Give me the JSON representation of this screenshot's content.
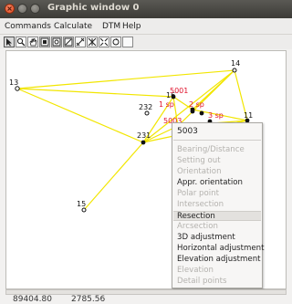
{
  "window": {
    "title": "Graphic window 0"
  },
  "menubar": {
    "items": [
      "Commands",
      "Calculate",
      "DTM",
      "Help"
    ]
  },
  "toolbar": {
    "tools": [
      "select-arrow-icon",
      "zoom-in-icon",
      "pan-hand-icon",
      "zoom-window-icon",
      "zoom-previous-icon",
      "zoom-all-icon",
      "measure-distance-icon",
      "intersection-icon",
      "fit-icon",
      "redraw-icon",
      "blank-icon"
    ]
  },
  "points": [
    {
      "label": "14"
    },
    {
      "label": "13"
    },
    {
      "label": "16"
    },
    {
      "label": "5001"
    },
    {
      "label": "232"
    },
    {
      "label": "1 sp"
    },
    {
      "label": "2 sp"
    },
    {
      "label": "3 sp"
    },
    {
      "label": "5003"
    },
    {
      "label": "11"
    },
    {
      "label": "231"
    },
    {
      "label": "15"
    }
  ],
  "context_menu": {
    "header": "5003",
    "items": [
      {
        "label": "Bearing/Distance",
        "enabled": false
      },
      {
        "label": "Setting out",
        "enabled": false
      },
      {
        "label": "Orientation",
        "enabled": false
      },
      {
        "label": "Appr. orientation",
        "enabled": true
      },
      {
        "label": "Polar point",
        "enabled": false
      },
      {
        "label": "Intersection",
        "enabled": false
      },
      {
        "label": "Resection",
        "enabled": true,
        "highlighted": true
      },
      {
        "label": "Arcsection",
        "enabled": false
      },
      {
        "label": "3D adjustment",
        "enabled": true
      },
      {
        "label": "Horizontal adjustment",
        "enabled": true
      },
      {
        "label": "Elevation adjustment",
        "enabled": true
      },
      {
        "label": "Elevation",
        "enabled": false
      },
      {
        "label": "Detail points",
        "enabled": false
      }
    ]
  },
  "status": {
    "x": "89404.80",
    "y": "2785.56"
  },
  "colors": {
    "line": "#f2e600",
    "point_label_red": "#e0102a",
    "point": "#111111"
  }
}
